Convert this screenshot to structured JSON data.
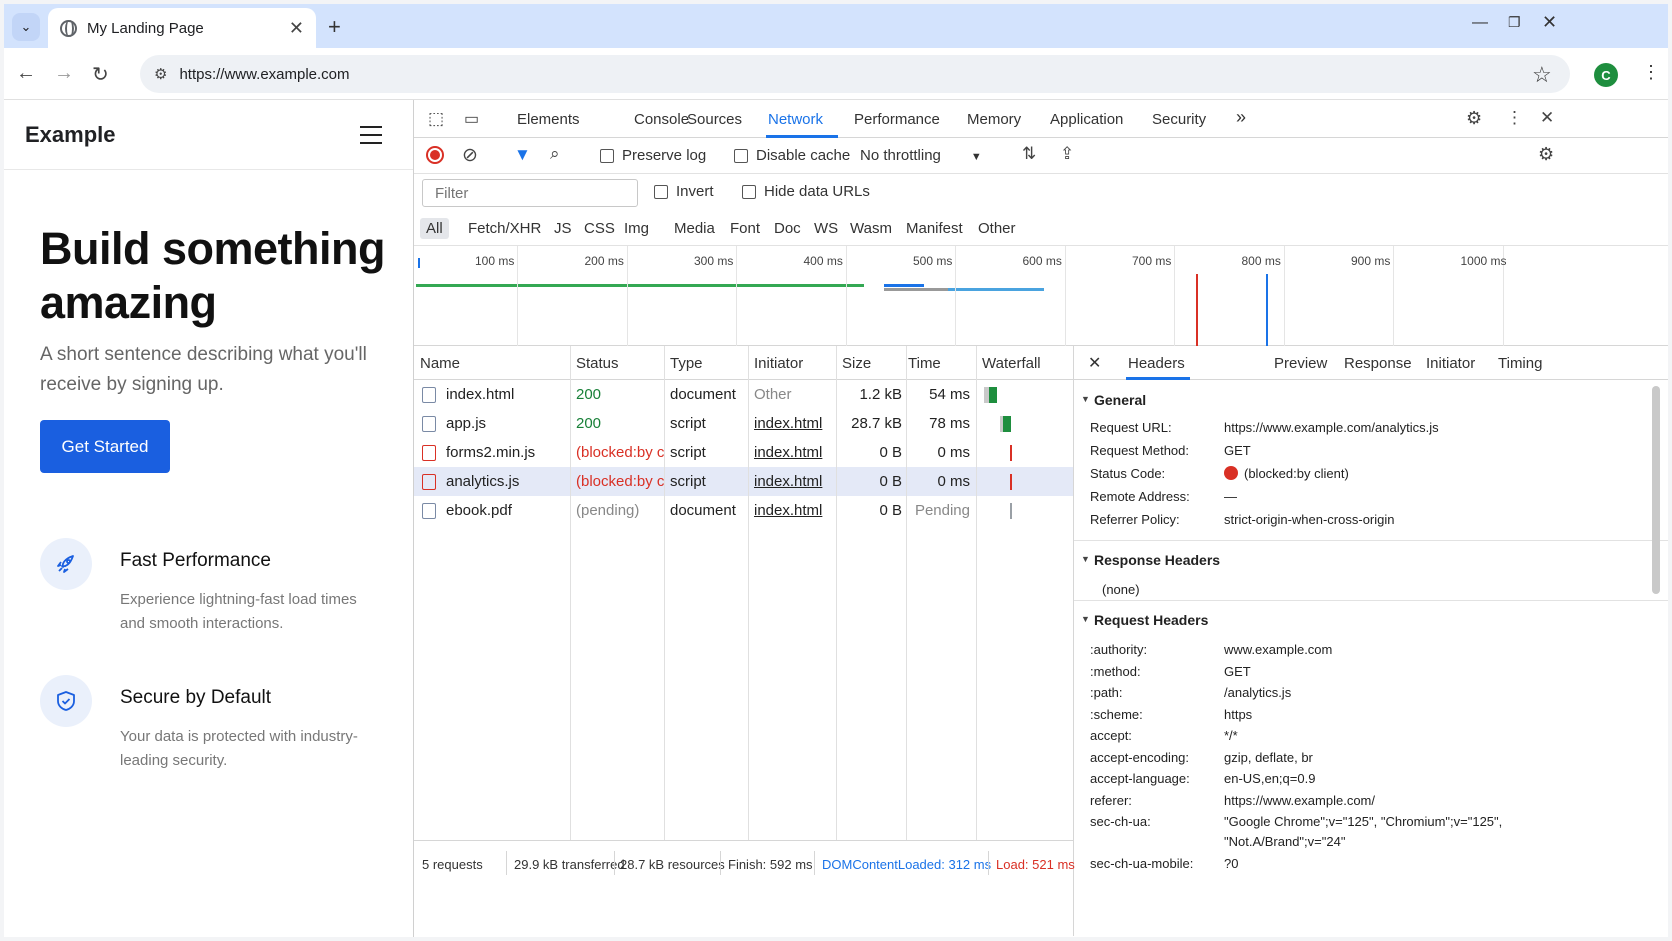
{
  "browser": {
    "tab_title": "My Landing Page",
    "url": "https://www.example.com",
    "profile_initial": "C"
  },
  "page": {
    "brand": "Example",
    "hero_title": "Build something amazing",
    "hero_subtitle": "A short sentence describing what you'll receive by signing up.",
    "cta_label": "Get Started",
    "features": [
      {
        "icon": "rocket-icon",
        "title": "Fast Performance",
        "desc": "Experience lightning-fast load times and smooth interactions."
      },
      {
        "icon": "shield-icon",
        "title": "Secure by Default",
        "desc": "Your data is protected with industry-leading security."
      }
    ]
  },
  "devtools": {
    "tabs": [
      "Elements",
      "Console",
      "Sources",
      "Network",
      "Performance",
      "Memory",
      "Application",
      "Security"
    ],
    "active_tab": "Network",
    "more_tabs": "»",
    "toolbar": {
      "preserve_log": "Preserve log",
      "disable_cache": "Disable cache",
      "throttling": "No throttling"
    },
    "filter": {
      "placeholder": "Filter",
      "invert": "Invert",
      "hide_data_urls": "Hide data URLs"
    },
    "type_filters": [
      "All",
      "Fetch/XHR",
      "JS",
      "CSS",
      "Img",
      "Media",
      "Font",
      "Doc",
      "WS",
      "Wasm",
      "Manifest",
      "Other"
    ],
    "active_type": "All",
    "timeline_ticks": [
      "100 ms",
      "200 ms",
      "300 ms",
      "400 ms",
      "500 ms",
      "600 ms",
      "700 ms",
      "800 ms",
      "900 ms",
      "1000 ms"
    ],
    "columns": [
      "Name",
      "Status",
      "Type",
      "Initiator",
      "Size",
      "Time",
      "Waterfall"
    ],
    "requests": [
      {
        "name": "index.html",
        "status": "200",
        "type": "document",
        "initiator": "Other",
        "size": "1.2 kB",
        "time": "54 ms"
      },
      {
        "name": "app.js",
        "status": "200",
        "type": "script",
        "initiator": "index.html",
        "size": "28.7 kB",
        "time": "78 ms"
      },
      {
        "name": "forms2.min.js",
        "status": "(blocked:by cl",
        "type": "script",
        "initiator": "index.html",
        "size": "0 B",
        "time": "0 ms"
      },
      {
        "name": "analytics.js",
        "status": "(blocked:by cl",
        "type": "script",
        "initiator": "index.html",
        "size": "0 B",
        "time": "0 ms"
      },
      {
        "name": "ebook.pdf",
        "status": "(pending)",
        "type": "document",
        "initiator": "index.html",
        "size": "0 B",
        "time": "Pending"
      }
    ],
    "status_bar": {
      "requests": "5 requests",
      "transferred": "29.9 kB transferred",
      "resources": "28.7 kB resources",
      "finish": "Finish: 592 ms",
      "dom_content_loaded": "DOMContentLoaded: 312 ms",
      "load": "Load: 521 ms"
    },
    "details": {
      "tabs": [
        "Headers",
        "Preview",
        "Response",
        "Initiator",
        "Timing"
      ],
      "active_tab": "Headers",
      "general_title": "General",
      "general": [
        {
          "k": "Request URL:",
          "v": "https://www.example.com/analytics.js"
        },
        {
          "k": "Request Method:",
          "v": "GET"
        },
        {
          "k": "Status Code:",
          "v": "(blocked:by client)"
        },
        {
          "k": "Remote Address:",
          "v": "—"
        },
        {
          "k": "Referrer Policy:",
          "v": "strict-origin-when-cross-origin"
        }
      ],
      "response_headers_title": "Response Headers",
      "response_headers_none": "(none)",
      "request_headers_title": "Request Headers",
      "request_headers": [
        {
          "k": ":authority:",
          "v": "www.example.com"
        },
        {
          "k": ":method:",
          "v": "GET"
        },
        {
          "k": ":path:",
          "v": "/analytics.js"
        },
        {
          "k": ":scheme:",
          "v": "https"
        },
        {
          "k": "accept:",
          "v": "*/*"
        },
        {
          "k": "accept-encoding:",
          "v": "gzip, deflate, br"
        },
        {
          "k": "accept-language:",
          "v": "en-US,en;q=0.9"
        },
        {
          "k": "referer:",
          "v": "https://www.example.com/"
        },
        {
          "k": "sec-ch-ua:",
          "v": "\"Google Chrome\";v=\"125\", \"Chromium\";v=\"125\",",
          "v2": "\"Not.A/Brand\";v=\"24\""
        },
        {
          "k": "sec-ch-ua-mobile:",
          "v": "?0"
        }
      ]
    }
  },
  "colors": {
    "accent": "#1a73e8",
    "cta": "#1a5fe0",
    "error": "#d93025",
    "ok": "#188038"
  }
}
